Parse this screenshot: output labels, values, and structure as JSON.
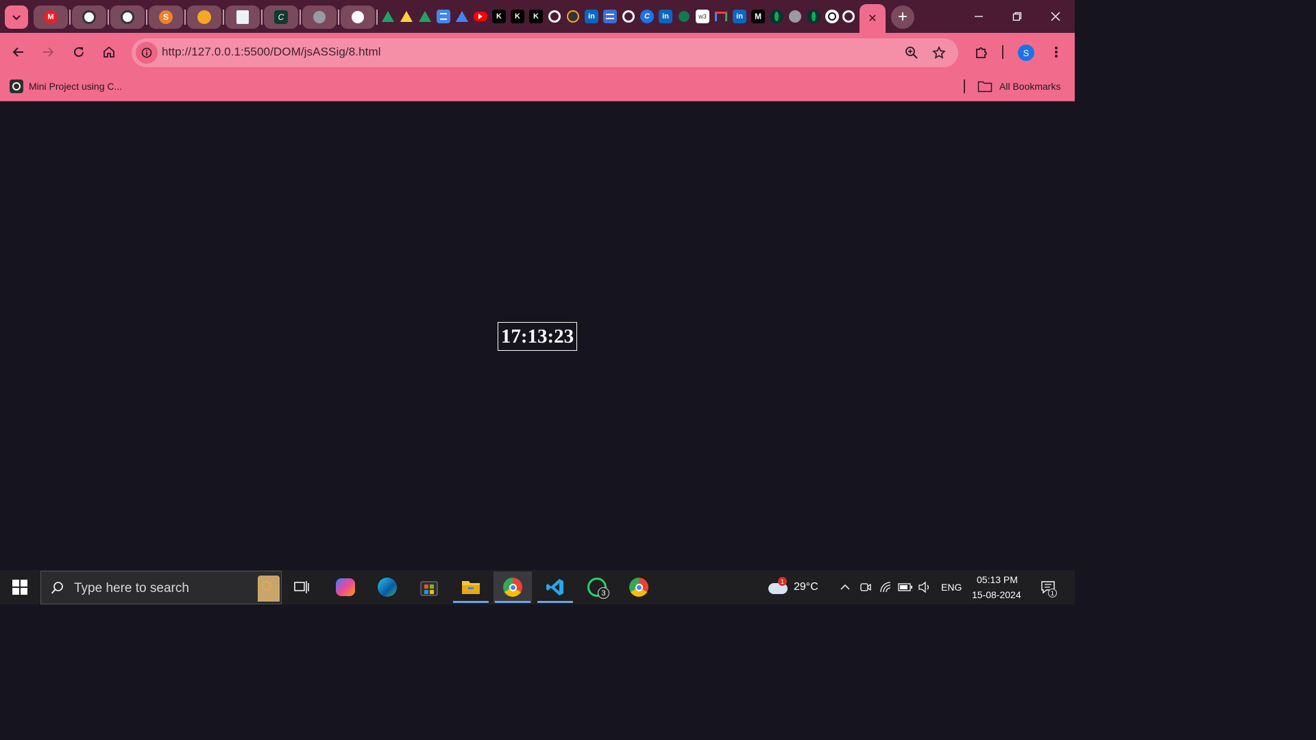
{
  "tabs": {
    "pinned_icons": [
      "gmail-icon",
      "wordpress-icon",
      "wordpress-icon",
      "stackshare-icon",
      "sunshine-icon",
      "document-icon",
      "codechef-icon",
      "globe-icon",
      "pwa-icon"
    ],
    "mini_icons": [
      "google-drive-icon",
      "google-drive-icon",
      "google-drive-icon",
      "google-docs-icon",
      "google-drive-icon",
      "youtube-icon",
      "k-icon",
      "k-icon",
      "k-icon",
      "github-icon",
      "swap-icon",
      "linkedin-icon",
      "forms-icon",
      "github-icon",
      "codechef-icon",
      "linkedin-icon",
      "whatsapp-icon",
      "w3schools-icon",
      "gmail-icon",
      "linkedin-icon",
      "medium-icon",
      "mongodb-icon",
      "globe-icon",
      "mongodb-icon",
      "openai-icon",
      "github-icon"
    ],
    "k_label": "K",
    "in_label": "in",
    "w3_label": "w3",
    "medium_label": "M",
    "active_close": "✕",
    "new_tab": "+"
  },
  "toolbar": {
    "url": "http://127.0.0.1:5500/DOM/jsASSig/8.html",
    "profile_initial": "S"
  },
  "bookmarks": {
    "item_label": "Mini Project using C...",
    "all_label": "All Bookmarks"
  },
  "page": {
    "clock_time": "17:13:23"
  },
  "taskbar": {
    "search_placeholder": "Type here to search",
    "whatsapp_badge": "3",
    "weather_badge": "1",
    "temperature": "29°C",
    "language": "ENG",
    "time": "05:13 PM",
    "date": "15-08-2024",
    "notification_count": "1"
  },
  "colors": {
    "tabstrip": "#4a1b33",
    "toolbar": "#f06b8c",
    "page_bg": "#16141f",
    "taskbar": "#1f1f22"
  }
}
